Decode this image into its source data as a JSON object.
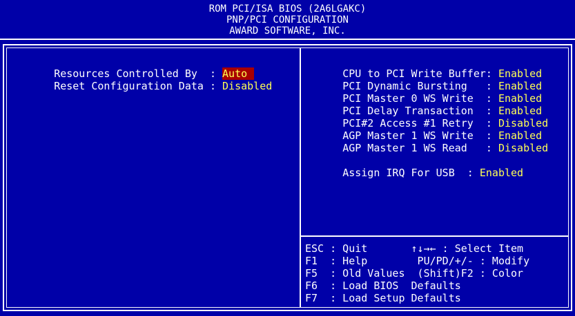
{
  "header": {
    "line1": "ROM PCI/ISA BIOS (2A6LGAKC)",
    "line2": "PNP/PCI CONFIGURATION",
    "line3": "AWARD SOFTWARE, INC."
  },
  "left": {
    "items": [
      {
        "label": "Resources Controlled By  : ",
        "value": "Auto"
      },
      {
        "label": "Reset Configuration Data : ",
        "value": "Disabled"
      }
    ]
  },
  "right": {
    "items": [
      {
        "label": "CPU to PCI Write Buffer: ",
        "value": "Enabled"
      },
      {
        "label": "PCI Dynamic Bursting   : ",
        "value": "Enabled"
      },
      {
        "label": "PCI Master 0 WS Write  : ",
        "value": "Enabled"
      },
      {
        "label": "PCI Delay Transaction  : ",
        "value": "Enabled"
      },
      {
        "label": "PCI#2 Access #1 Retry  : ",
        "value": "Disabled"
      },
      {
        "label": "AGP Master 1 WS Write  : ",
        "value": "Enabled"
      },
      {
        "label": "AGP Master 1 WS Read   : ",
        "value": "Disabled"
      }
    ],
    "usb": {
      "label": "Assign IRQ For USB  : ",
      "value": "Enabled"
    }
  },
  "help": {
    "lines": [
      "ESC : Quit       ↑↓→← : Select Item",
      "F1  : Help        PU/PD/+/- : Modify",
      "F5  : Old Values  (Shift)F2 : Color",
      "F6  : Load BIOS  Defaults",
      "F7  : Load Setup Defaults"
    ]
  },
  "colors": {
    "background": "#0000a8",
    "text": "#ffffff",
    "value": "#ffff54",
    "selection": "#a80000"
  }
}
